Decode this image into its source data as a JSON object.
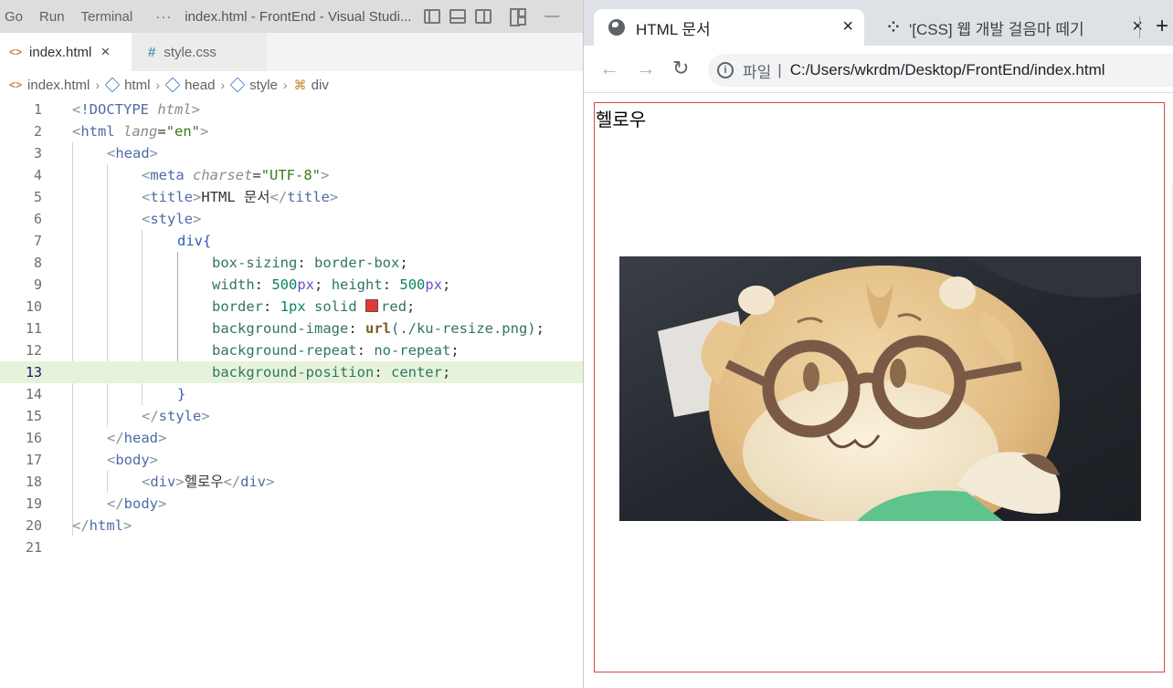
{
  "vscode": {
    "menus": [
      "Go",
      "Run",
      "Terminal"
    ],
    "more": "···",
    "window_title": "index.html - FrontEnd - Visual Studi...",
    "minimize": "—",
    "tabs": [
      {
        "label": "index.html",
        "close": "×"
      },
      {
        "label": "style.css"
      }
    ],
    "breadcrumb": [
      "index.html",
      "html",
      "head",
      "style",
      "div"
    ],
    "breadcrumb_sep": "›",
    "active_line": 13,
    "line_numbers": [
      "1",
      "2",
      "3",
      "4",
      "5",
      "6",
      "7",
      "8",
      "9",
      "10",
      "11",
      "12",
      "13",
      "14",
      "15",
      "16",
      "17",
      "18",
      "19",
      "20",
      "21"
    ],
    "code": {
      "doctype_kw": "!DOCTYPE",
      "doctype_val": "html",
      "html_tag": "html",
      "lang_attr": "lang",
      "lang_val": "\"en\"",
      "head_tag": "head",
      "meta_tag": "meta",
      "charset_attr": "charset",
      "charset_val": "\"UTF-8\"",
      "title_tag": "title",
      "title_text": "HTML 문서",
      "style_tag": "style",
      "selector": "div{",
      "prop_box_sizing": "box-sizing",
      "val_box_sizing": "border-box",
      "prop_width": "width",
      "val_width_num": "500",
      "prop_height": "height",
      "val_height_num": "500",
      "unit_px": "px",
      "prop_border": "border",
      "val_border_num": "1px",
      "val_border_style": "solid",
      "val_border_color": "red",
      "swatch_color": "#e53935",
      "prop_bg_image": "background-image",
      "val_bg_fn": "url",
      "val_bg_path": "(./ku-resize.png)",
      "prop_bg_repeat": "background-repeat",
      "val_bg_repeat": "no-repeat",
      "prop_bg_position": "background-position",
      "val_bg_position": "center",
      "close_brace": "}",
      "body_tag": "body",
      "div_tag": "div",
      "div_text": "헬로우"
    }
  },
  "browser": {
    "tabs": [
      {
        "title": "HTML 문서",
        "close": "×",
        "favicon": "globe-icon"
      },
      {
        "title": "'[CSS] 웹 개발 걸음마 떼기",
        "close": "×",
        "favicon": "tistory-icon"
      }
    ],
    "new_tab": "+",
    "nav": {
      "back": "←",
      "forward": "→",
      "reload": "↻"
    },
    "address": {
      "info": "i",
      "scheme": "파일",
      "separator": "|",
      "url": "C:/Users/wkrdm/Desktop/FrontEnd/index.html"
    },
    "content": {
      "text": "헬로우",
      "image": "plush-toy-with-glasses"
    },
    "colors": {
      "div_border": "#e0413a",
      "tab_strip": "#dee1e6",
      "omnibox": "#f1f3f4"
    }
  }
}
